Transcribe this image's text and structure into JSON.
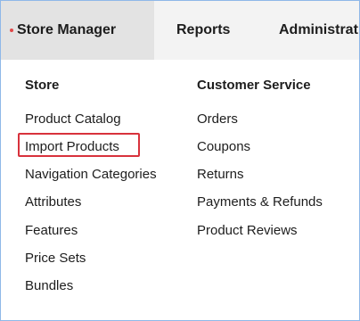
{
  "nav": {
    "tabs": [
      {
        "label": "Store Manager"
      },
      {
        "label": "Reports"
      },
      {
        "label": "Administrat"
      }
    ]
  },
  "menu": {
    "store": {
      "heading": "Store",
      "items": [
        "Product Catalog",
        "Import Products",
        "Navigation Categories",
        "Attributes",
        "Features",
        "Price Sets",
        "Bundles"
      ]
    },
    "customer_service": {
      "heading": "Customer Service",
      "items": [
        "Orders",
        "Coupons",
        "Returns",
        "Payments & Refunds",
        "Product Reviews"
      ]
    }
  },
  "colors": {
    "highlight_border": "#d8323c",
    "active_dot": "#e04848",
    "frame_border": "#8fb8e8"
  }
}
